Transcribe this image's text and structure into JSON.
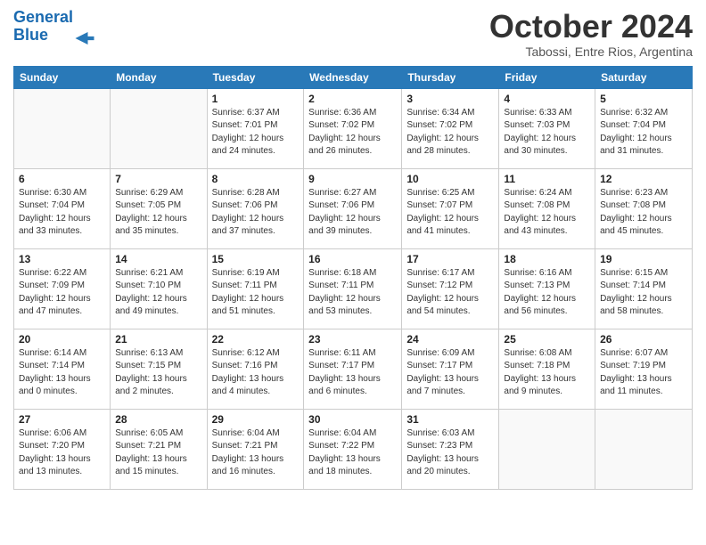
{
  "header": {
    "logo_line1": "General",
    "logo_line2": "Blue",
    "month": "October 2024",
    "location": "Tabossi, Entre Rios, Argentina"
  },
  "weekdays": [
    "Sunday",
    "Monday",
    "Tuesday",
    "Wednesday",
    "Thursday",
    "Friday",
    "Saturday"
  ],
  "weeks": [
    [
      {
        "day": "",
        "info": ""
      },
      {
        "day": "",
        "info": ""
      },
      {
        "day": "1",
        "info": "Sunrise: 6:37 AM\nSunset: 7:01 PM\nDaylight: 12 hours\nand 24 minutes."
      },
      {
        "day": "2",
        "info": "Sunrise: 6:36 AM\nSunset: 7:02 PM\nDaylight: 12 hours\nand 26 minutes."
      },
      {
        "day": "3",
        "info": "Sunrise: 6:34 AM\nSunset: 7:02 PM\nDaylight: 12 hours\nand 28 minutes."
      },
      {
        "day": "4",
        "info": "Sunrise: 6:33 AM\nSunset: 7:03 PM\nDaylight: 12 hours\nand 30 minutes."
      },
      {
        "day": "5",
        "info": "Sunrise: 6:32 AM\nSunset: 7:04 PM\nDaylight: 12 hours\nand 31 minutes."
      }
    ],
    [
      {
        "day": "6",
        "info": "Sunrise: 6:30 AM\nSunset: 7:04 PM\nDaylight: 12 hours\nand 33 minutes."
      },
      {
        "day": "7",
        "info": "Sunrise: 6:29 AM\nSunset: 7:05 PM\nDaylight: 12 hours\nand 35 minutes."
      },
      {
        "day": "8",
        "info": "Sunrise: 6:28 AM\nSunset: 7:06 PM\nDaylight: 12 hours\nand 37 minutes."
      },
      {
        "day": "9",
        "info": "Sunrise: 6:27 AM\nSunset: 7:06 PM\nDaylight: 12 hours\nand 39 minutes."
      },
      {
        "day": "10",
        "info": "Sunrise: 6:25 AM\nSunset: 7:07 PM\nDaylight: 12 hours\nand 41 minutes."
      },
      {
        "day": "11",
        "info": "Sunrise: 6:24 AM\nSunset: 7:08 PM\nDaylight: 12 hours\nand 43 minutes."
      },
      {
        "day": "12",
        "info": "Sunrise: 6:23 AM\nSunset: 7:08 PM\nDaylight: 12 hours\nand 45 minutes."
      }
    ],
    [
      {
        "day": "13",
        "info": "Sunrise: 6:22 AM\nSunset: 7:09 PM\nDaylight: 12 hours\nand 47 minutes."
      },
      {
        "day": "14",
        "info": "Sunrise: 6:21 AM\nSunset: 7:10 PM\nDaylight: 12 hours\nand 49 minutes."
      },
      {
        "day": "15",
        "info": "Sunrise: 6:19 AM\nSunset: 7:11 PM\nDaylight: 12 hours\nand 51 minutes."
      },
      {
        "day": "16",
        "info": "Sunrise: 6:18 AM\nSunset: 7:11 PM\nDaylight: 12 hours\nand 53 minutes."
      },
      {
        "day": "17",
        "info": "Sunrise: 6:17 AM\nSunset: 7:12 PM\nDaylight: 12 hours\nand 54 minutes."
      },
      {
        "day": "18",
        "info": "Sunrise: 6:16 AM\nSunset: 7:13 PM\nDaylight: 12 hours\nand 56 minutes."
      },
      {
        "day": "19",
        "info": "Sunrise: 6:15 AM\nSunset: 7:14 PM\nDaylight: 12 hours\nand 58 minutes."
      }
    ],
    [
      {
        "day": "20",
        "info": "Sunrise: 6:14 AM\nSunset: 7:14 PM\nDaylight: 13 hours\nand 0 minutes."
      },
      {
        "day": "21",
        "info": "Sunrise: 6:13 AM\nSunset: 7:15 PM\nDaylight: 13 hours\nand 2 minutes."
      },
      {
        "day": "22",
        "info": "Sunrise: 6:12 AM\nSunset: 7:16 PM\nDaylight: 13 hours\nand 4 minutes."
      },
      {
        "day": "23",
        "info": "Sunrise: 6:11 AM\nSunset: 7:17 PM\nDaylight: 13 hours\nand 6 minutes."
      },
      {
        "day": "24",
        "info": "Sunrise: 6:09 AM\nSunset: 7:17 PM\nDaylight: 13 hours\nand 7 minutes."
      },
      {
        "day": "25",
        "info": "Sunrise: 6:08 AM\nSunset: 7:18 PM\nDaylight: 13 hours\nand 9 minutes."
      },
      {
        "day": "26",
        "info": "Sunrise: 6:07 AM\nSunset: 7:19 PM\nDaylight: 13 hours\nand 11 minutes."
      }
    ],
    [
      {
        "day": "27",
        "info": "Sunrise: 6:06 AM\nSunset: 7:20 PM\nDaylight: 13 hours\nand 13 minutes."
      },
      {
        "day": "28",
        "info": "Sunrise: 6:05 AM\nSunset: 7:21 PM\nDaylight: 13 hours\nand 15 minutes."
      },
      {
        "day": "29",
        "info": "Sunrise: 6:04 AM\nSunset: 7:21 PM\nDaylight: 13 hours\nand 16 minutes."
      },
      {
        "day": "30",
        "info": "Sunrise: 6:04 AM\nSunset: 7:22 PM\nDaylight: 13 hours\nand 18 minutes."
      },
      {
        "day": "31",
        "info": "Sunrise: 6:03 AM\nSunset: 7:23 PM\nDaylight: 13 hours\nand 20 minutes."
      },
      {
        "day": "",
        "info": ""
      },
      {
        "day": "",
        "info": ""
      }
    ]
  ]
}
